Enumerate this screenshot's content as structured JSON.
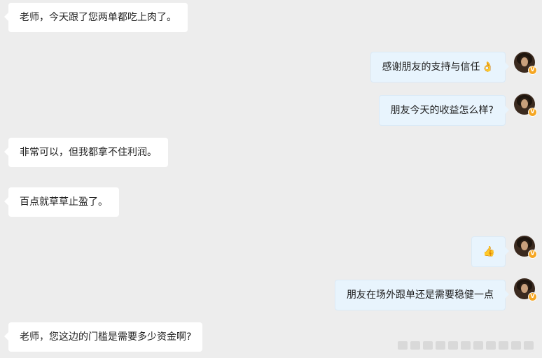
{
  "messages": [
    {
      "side": "left",
      "text": "老师，今天跟了您两单都吃上肉了。"
    },
    {
      "side": "right",
      "text": "感谢朋友的支持与信任",
      "emoji": "👌"
    },
    {
      "side": "right",
      "text": "朋友今天的收益怎么样?"
    },
    {
      "side": "left",
      "text": "非常可以，但我都拿不住利润。"
    },
    {
      "side": "left",
      "text": "百点就草草止盈了。"
    },
    {
      "side": "right",
      "text": "",
      "emoji": "👍"
    },
    {
      "side": "right",
      "text": "朋友在场外跟单还是需要稳健一点"
    },
    {
      "side": "left",
      "text": "老师，您这边的门槛是需要多少资金啊?"
    }
  ],
  "avatar": {
    "badge": "V",
    "badge_color": "#f5a623"
  },
  "colors": {
    "background": "#ededed",
    "left_bubble": "#ffffff",
    "right_bubble": "#e8f4fd"
  }
}
